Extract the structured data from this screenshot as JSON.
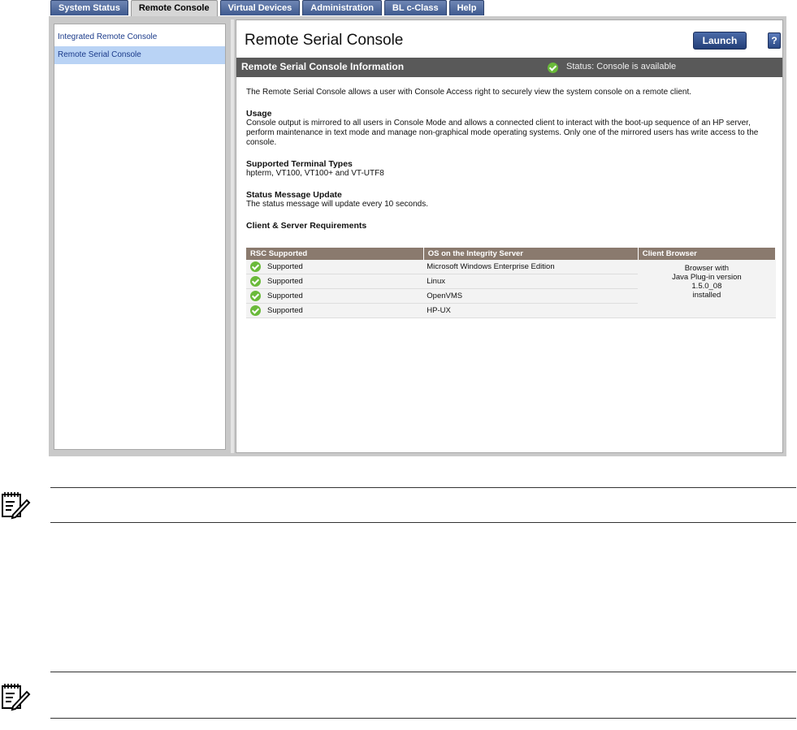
{
  "tabs": [
    "System Status",
    "Remote Console",
    "Virtual Devices",
    "Administration",
    "BL c-Class",
    "Help"
  ],
  "active_tab": "Remote Console",
  "sidebar": {
    "items": [
      {
        "label": "Integrated Remote Console",
        "selected": false
      },
      {
        "label": "Remote Serial Console",
        "selected": true
      }
    ]
  },
  "main": {
    "title": "Remote Serial Console",
    "launch_label": "Launch",
    "help_label": "?",
    "info_title": "Remote Serial Console Information",
    "status_text": "Status: Console is available",
    "intro": "The Remote Serial Console allows a user with Console Access right to securely view the system console on a remote client.",
    "usage_heading": "Usage",
    "usage_text": "Console output is mirrored to all users in Console Mode and allows a connected client to interact with the boot-up sequence of an HP server, perform maintenance in text mode and manage non-graphical mode operating systems. Only one of the mirrored users has write access to the console.",
    "terminal_heading": "Supported Terminal Types",
    "terminal_text": "hpterm, VT100, VT100+ and VT-UTF8",
    "status_update_heading": "Status Message Update",
    "status_update_text": "The status message will update every 10 seconds.",
    "requirements_heading": "Client & Server Requirements"
  },
  "requirements": {
    "headers": [
      "RSC Supported",
      "OS on the Integrity Server",
      "Client Browser"
    ],
    "rows": [
      {
        "rsc": "Supported",
        "os": "Microsoft Windows Enterprise Edition"
      },
      {
        "rsc": "Supported",
        "os": "Linux"
      },
      {
        "rsc": "Supported",
        "os": "OpenVMS"
      },
      {
        "rsc": "Supported",
        "os": "HP-UX"
      }
    ],
    "browser_lines": [
      "Browser with",
      "Java Plug-in version",
      "1.5.0_08",
      "installed"
    ]
  },
  "colors": {
    "tab_bg": "#3f5a8f",
    "info_bar": "#595959",
    "table_header": "#8a7a6e",
    "status_ok": "#6aba3a"
  },
  "icons": {
    "status": "check-circle-icon",
    "note": "note-pad-icon"
  }
}
